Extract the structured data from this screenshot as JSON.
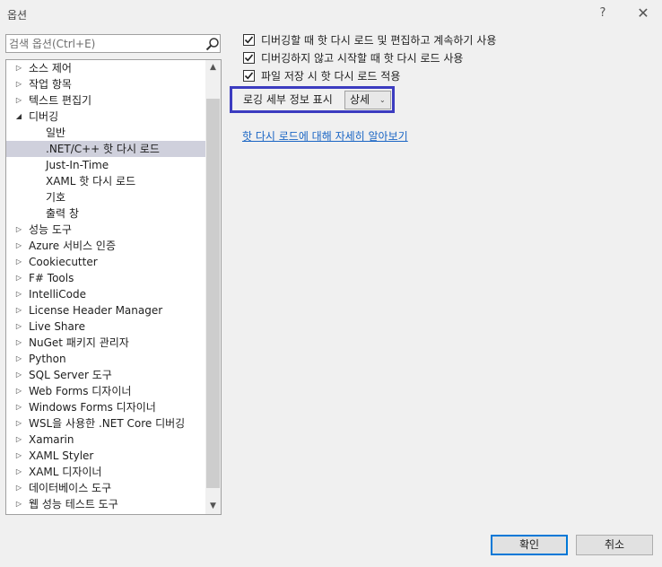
{
  "window": {
    "title": "옵션",
    "help": "?",
    "close": "✕"
  },
  "search": {
    "placeholder": "검색 옵션(Ctrl+E)",
    "icon": "search-icon"
  },
  "tree": {
    "items": [
      {
        "label": "소스 제어",
        "level": 0,
        "arrow": "▷"
      },
      {
        "label": "작업 항목",
        "level": 0,
        "arrow": "▷"
      },
      {
        "label": "텍스트 편집기",
        "level": 0,
        "arrow": "▷"
      },
      {
        "label": "디버깅",
        "level": 0,
        "arrow": "◢"
      },
      {
        "label": "일반",
        "level": 1,
        "arrow": ""
      },
      {
        "label": ".NET/C++ 핫 다시 로드",
        "level": 1,
        "arrow": "",
        "selected": true
      },
      {
        "label": "Just-In-Time",
        "level": 1,
        "arrow": ""
      },
      {
        "label": "XAML 핫 다시 로드",
        "level": 1,
        "arrow": ""
      },
      {
        "label": "기호",
        "level": 1,
        "arrow": ""
      },
      {
        "label": "출력 창",
        "level": 1,
        "arrow": ""
      },
      {
        "label": "성능 도구",
        "level": 0,
        "arrow": "▷"
      },
      {
        "label": "Azure 서비스 인증",
        "level": 0,
        "arrow": "▷"
      },
      {
        "label": "Cookiecutter",
        "level": 0,
        "arrow": "▷"
      },
      {
        "label": "F# Tools",
        "level": 0,
        "arrow": "▷"
      },
      {
        "label": "IntelliCode",
        "level": 0,
        "arrow": "▷"
      },
      {
        "label": "License Header Manager",
        "level": 0,
        "arrow": "▷"
      },
      {
        "label": "Live Share",
        "level": 0,
        "arrow": "▷"
      },
      {
        "label": "NuGet 패키지 관리자",
        "level": 0,
        "arrow": "▷"
      },
      {
        "label": "Python",
        "level": 0,
        "arrow": "▷"
      },
      {
        "label": "SQL Server 도구",
        "level": 0,
        "arrow": "▷"
      },
      {
        "label": "Web Forms 디자이너",
        "level": 0,
        "arrow": "▷"
      },
      {
        "label": "Windows Forms 디자이너",
        "level": 0,
        "arrow": "▷"
      },
      {
        "label": "WSL을 사용한 .NET Core 디버깅",
        "level": 0,
        "arrow": "▷"
      },
      {
        "label": "Xamarin",
        "level": 0,
        "arrow": "▷"
      },
      {
        "label": "XAML Styler",
        "level": 0,
        "arrow": "▷"
      },
      {
        "label": "XAML 디자이너",
        "level": 0,
        "arrow": "▷"
      },
      {
        "label": "데이터베이스 도구",
        "level": 0,
        "arrow": "▷"
      },
      {
        "label": "웹 성능 테스트 도구",
        "level": 0,
        "arrow": "▷"
      }
    ],
    "scroll_up": "▲",
    "scroll_down": "▼"
  },
  "options": {
    "checkboxes": [
      {
        "label": "디버깅할 때 핫 다시 로드 및 편집하고 계속하기 사용",
        "checked": true
      },
      {
        "label": "디버깅하지 않고 시작할 때 핫 다시 로드 사용",
        "checked": true
      },
      {
        "label": "파일 저장 시 핫 다시 로드 적용",
        "checked": true
      }
    ],
    "logging_label": "로깅 세부 정보 표시",
    "logging_value": "상세",
    "logging_arrow": "⌄",
    "learn_more_link": "핫 다시 로드에 대해 자세히 알아보기"
  },
  "buttons": {
    "ok": "확인",
    "cancel": "취소"
  },
  "colors": {
    "highlight_border": "#3c3cc0",
    "link": "#1a65c4",
    "selection": "#cfd0dc",
    "ok_border": "#0078d7"
  }
}
